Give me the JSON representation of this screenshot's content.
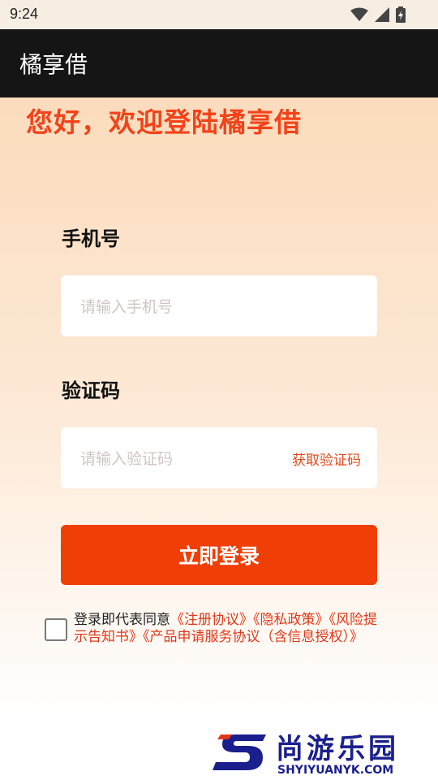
{
  "status_bar": {
    "time": "9:24"
  },
  "app_bar": {
    "title": "橘享借"
  },
  "welcome": "您好，欢迎登陆橘享借",
  "phone": {
    "label": "手机号",
    "placeholder": "请输入手机号",
    "value": ""
  },
  "code": {
    "label": "验证码",
    "placeholder": "请输入验证码",
    "value": "",
    "get_code_label": "获取验证码"
  },
  "login_button": "立即登录",
  "agreement": {
    "checked": false,
    "prefix": "登录即代表同意",
    "links": [
      "《注册协议》",
      "《隐私政策》",
      "《风险提示告知书》",
      "《产品申请服务协议（含信息授权）》"
    ]
  },
  "watermark": {
    "name": "尚游乐园",
    "url": "SHYIYUANYK.COM"
  },
  "colors": {
    "accent": "#ef3f06",
    "link": "#e0391a",
    "app_bar": "#151515"
  }
}
